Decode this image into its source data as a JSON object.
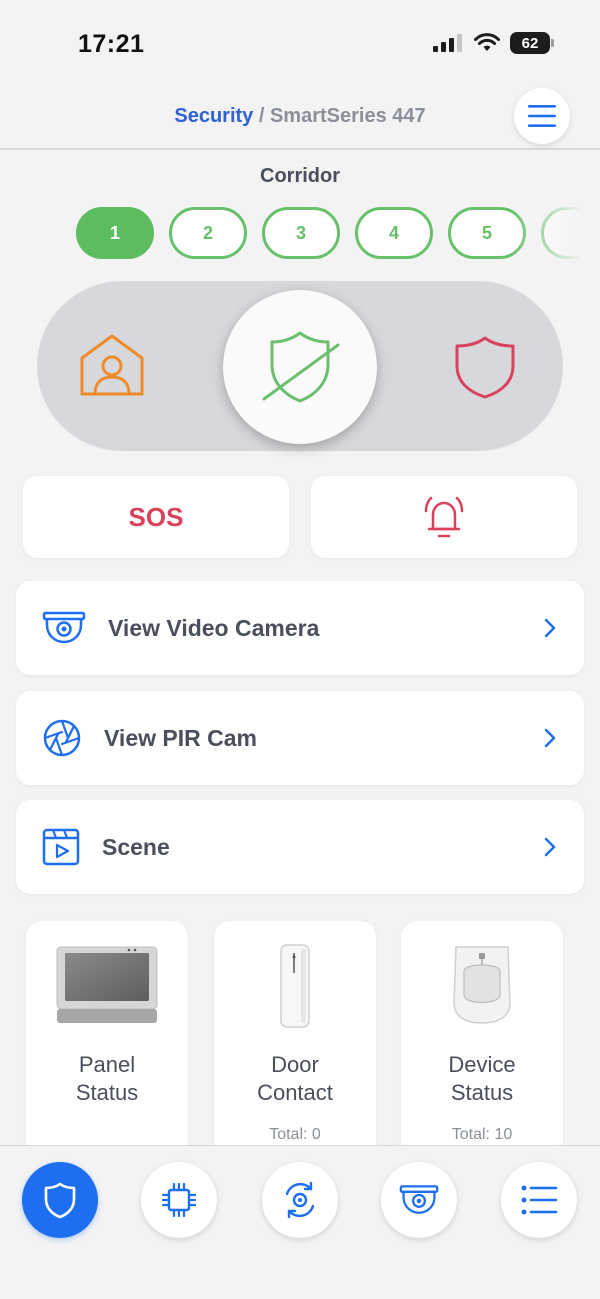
{
  "status_bar": {
    "time": "17:21",
    "battery": "62"
  },
  "header": {
    "breadcrumb_root": "Security",
    "breadcrumb_sep": " / ",
    "breadcrumb_current": "SmartSeries 447"
  },
  "zone_title": "Corridor",
  "zones": [
    "1",
    "2",
    "3",
    "4",
    "5"
  ],
  "active_zone": "1",
  "arm_modes": [
    "home-icon",
    "disarmed-shield-icon",
    "armed-shield-icon"
  ],
  "sos_label": "SOS",
  "list": {
    "video_camera": "View Video Camera",
    "pir_cam": "View PIR Cam",
    "scene": "Scene"
  },
  "tiles": {
    "panel": {
      "line1": "Panel",
      "line2": "Status"
    },
    "door": {
      "line1": "Door",
      "line2": "Contact",
      "total": "Total: 0"
    },
    "device": {
      "line1": "Device",
      "line2": "Status",
      "total": "Total: 10"
    }
  },
  "colors": {
    "accent": "#1e6ff0",
    "green": "#5cbc60",
    "red": "#d9425a",
    "orange": "#ef8a2a"
  }
}
